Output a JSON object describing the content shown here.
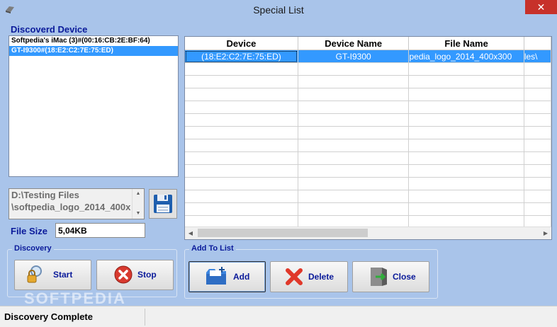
{
  "window": {
    "title": "Special List",
    "close_glyph": "✕"
  },
  "discovered": {
    "label": "Discoverd Device",
    "items": [
      "Softpedia's iMac (3)#(00:16:CB:2E:BF:64)",
      "GT-I9300#(18:E2:C2:7E:75:ED)"
    ],
    "selected_index": 1
  },
  "path": {
    "line1": "D:\\Testing Files",
    "line2": "\\softpedia_logo_2014_400x"
  },
  "filesize": {
    "label": "File Size",
    "value": "5,04KB"
  },
  "discovery_group": {
    "title": "Discovery",
    "start_label": "Start",
    "stop_label": "Stop"
  },
  "addlist_group": {
    "title": "Add To List",
    "add_label": "Add",
    "delete_label": "Delete",
    "close_label": "Close"
  },
  "grid": {
    "columns": [
      "Device",
      "Device Name",
      "File Name"
    ],
    "rows": [
      {
        "device": "(18:E2:C2:7E:75:ED)",
        "device_name": "GT-I9300",
        "file_name": "pedia_logo_2014_400x300",
        "extra": "les\\"
      }
    ]
  },
  "status": {
    "text": "Discovery Complete"
  },
  "watermark": "SOFTPEDIA"
}
